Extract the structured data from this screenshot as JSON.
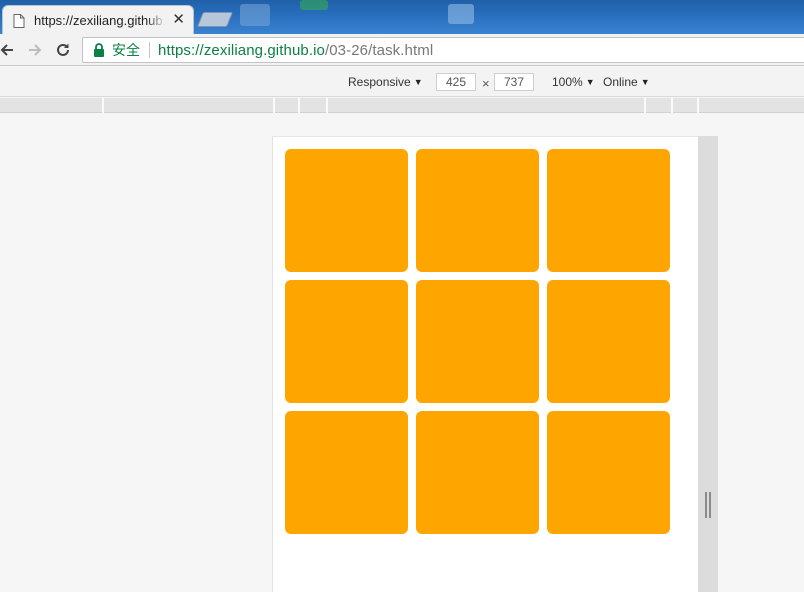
{
  "tab": {
    "title": "https://zexiliang.github.io/03-26/task.html",
    "close_symbol": "✕",
    "icon": "page-icon"
  },
  "toolbar": {
    "back_icon": "arrow-left-icon",
    "forward_icon": "arrow-right-icon",
    "reload_icon": "reload-icon"
  },
  "address_bar": {
    "secure_label": "安全",
    "url_host": "https://zexiliang.github.io",
    "url_path": "/03-26/task.html",
    "lock_icon": "lock-icon",
    "secure_color": "#0b8043"
  },
  "device_toolbar": {
    "device_mode": "Responsive",
    "width": "425",
    "times_symbol": "×",
    "height": "737",
    "zoom": "100%",
    "throttling": "Online",
    "caret_symbol": "▼"
  },
  "page": {
    "tile_color": "#ffa500",
    "tile_count": 9
  }
}
